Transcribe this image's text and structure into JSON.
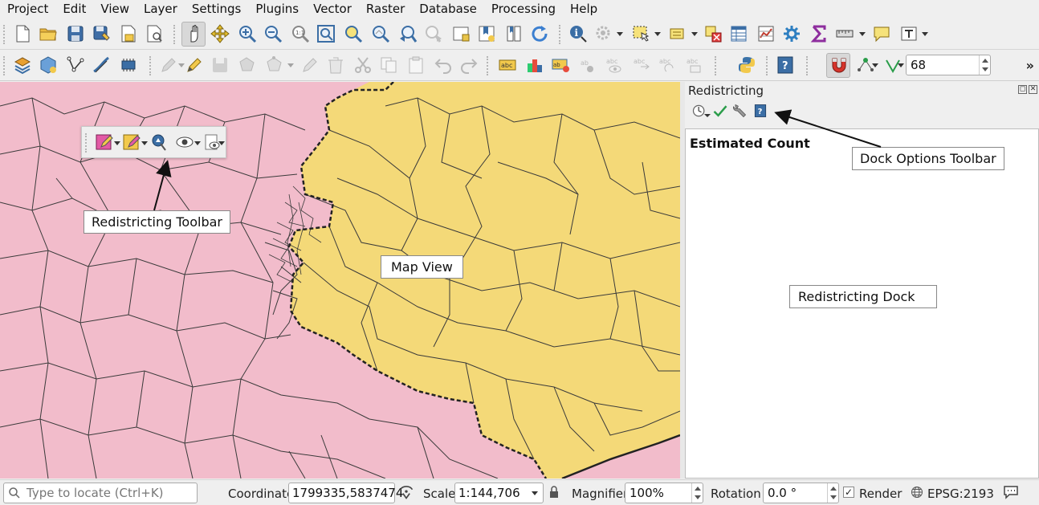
{
  "menu": [
    "Project",
    "Edit",
    "View",
    "Layer",
    "Settings",
    "Plugins",
    "Vector",
    "Raster",
    "Database",
    "Processing",
    "Help"
  ],
  "toolbar": {
    "snapping_tolerance": "68",
    "overflow_label": "»"
  },
  "dock": {
    "title": "Redistricting",
    "content_heading": "Estimated Count",
    "float_ctrl": "◻",
    "close_ctrl": "✕"
  },
  "callouts": {
    "redistricting_toolbar": "Redistricting Toolbar",
    "map_view": "Map View",
    "dock_options_toolbar": "Dock Options Toolbar",
    "redistricting_dock": "Redistricting Dock"
  },
  "statusbar": {
    "locator_placeholder": "Type to locate (Ctrl+K)",
    "coordinate_label": "Coordinate",
    "coordinate_value": "1799335,5837474",
    "scale_label": "Scale",
    "scale_value": "1:144,706",
    "magnifier_label": "Magnifier",
    "magnifier_value": "100%",
    "rotation_label": "Rotation",
    "rotation_value": "0.0 °",
    "render_label": "Render",
    "render_checked": true,
    "crs_label": "EPSG:2193"
  },
  "colors": {
    "district_pink": "#f2bccb",
    "district_yellow": "#f4d978",
    "boundary": "#3a3a3a"
  }
}
